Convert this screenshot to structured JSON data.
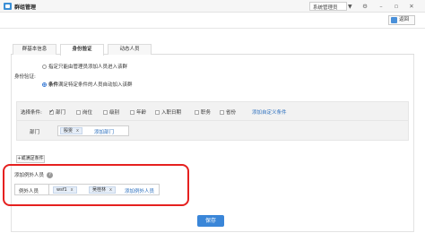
{
  "app": {
    "title": "群组管理"
  },
  "role_select": {
    "value": "系统管理员"
  },
  "toolbar": {
    "back_label": "返回"
  },
  "tabs": [
    {
      "label": "群基本信息",
      "active": false
    },
    {
      "label": "身份验证",
      "active": true
    },
    {
      "label": "动态人员",
      "active": false
    }
  ],
  "identity": {
    "option_specified": {
      "prefix": "指定",
      "text": "只能由管理员添加人员进入该群"
    },
    "label": "身份验证:",
    "option_condition": {
      "prefix": "条件",
      "text": "满足特定条件的人员自动加入该群"
    }
  },
  "conditions": {
    "label": "选择条件:",
    "items": [
      {
        "label": "部门",
        "checked": true
      },
      {
        "label": "岗位",
        "checked": false
      },
      {
        "label": "级别",
        "checked": false
      },
      {
        "label": "年龄",
        "checked": false
      },
      {
        "label": "入职日期",
        "checked": false
      },
      {
        "label": "职务",
        "checked": false
      },
      {
        "label": "省份",
        "checked": false
      }
    ],
    "add_custom_link": "添加自定义条件",
    "dept_label": "部门",
    "dept_tags": [
      "殷雯"
    ],
    "add_dept_link": "添加部门"
  },
  "or_condition_button": "+或满足条件",
  "exceptions": {
    "title": "添加例外人员",
    "help": "?",
    "label": "例外人员",
    "tags": [
      "wsf1",
      "吴桂林"
    ],
    "tag_remove": "x",
    "add_link": "添加例外人员"
  },
  "save_label": "保存"
}
